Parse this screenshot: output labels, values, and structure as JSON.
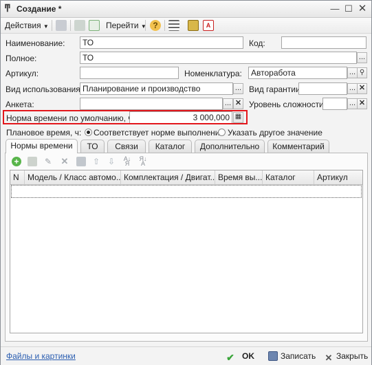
{
  "window": {
    "title": "Создание *"
  },
  "toolbar": {
    "actions": "Действия",
    "goto": "Перейти"
  },
  "form": {
    "name_label": "Наименование:",
    "name_value": "ТО",
    "code_label": "Код:",
    "code_value": "",
    "full_label": "Полное:",
    "full_value": "ТО",
    "article_label": "Артикул:",
    "article_value": "",
    "nomenclature_label": "Номенклатура:",
    "nomenclature_value": "Авторабота",
    "usage_label": "Вид использования:",
    "usage_value": "Планирование и производство",
    "warranty_label": "Вид гарантии:",
    "warranty_value": "",
    "form_label": "Анкета:",
    "form_value": "",
    "complexity_label": "Уровень сложности:",
    "complexity_value": "",
    "default_time_label": "Норма времени по умолчанию, ч:",
    "default_time_value": "3 000,000",
    "planned_label": "Плановое время, ч:",
    "radio_match": "Соответствует норме выполнения",
    "radio_other": "Указать другое значение"
  },
  "tabs": [
    "Нормы времени",
    "ТО",
    "Связи",
    "Каталог",
    "Дополнительно",
    "Комментарий"
  ],
  "table": {
    "columns": [
      "N",
      "Модель / Класс автомо...",
      "Комплектация / Двигат...",
      "Время вы...",
      "Каталог",
      "Артикул"
    ]
  },
  "footer": {
    "files_link": "Файлы и картинки",
    "ok": "OK",
    "save": "Записать",
    "close": "Закрыть"
  }
}
